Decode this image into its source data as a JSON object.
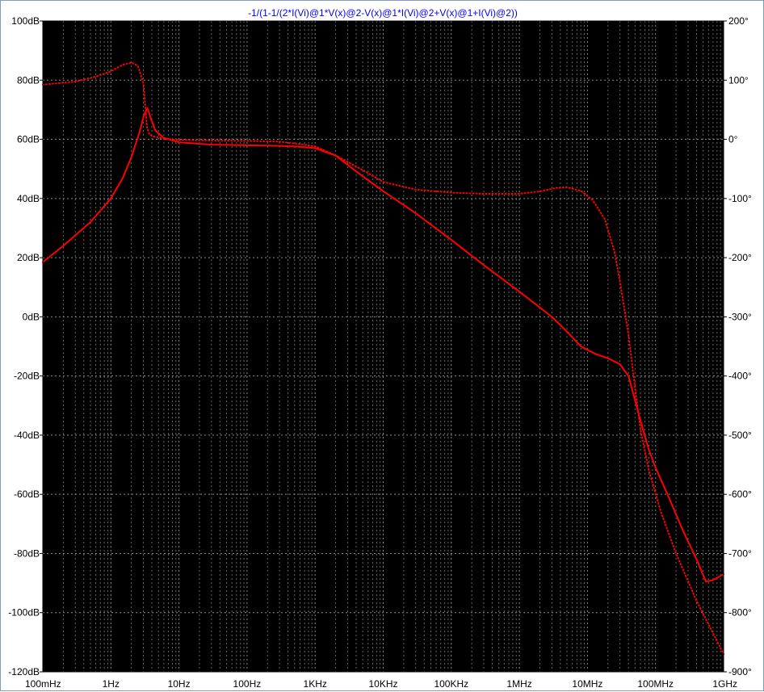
{
  "window": {
    "background": "#ffffff",
    "plot_background": "#000000",
    "grid_color": "#8a8a8a",
    "title_color": "#0000ff",
    "trace_color": "#ff0000"
  },
  "chart_data": {
    "type": "line",
    "title": "-1/(1-1/(2*I(Vi)@1*V(x)@2-V(x)@1*I(Vi)@2+V(x)@1+I(Vi)@2))",
    "x_scale": "log",
    "xlim": [
      0.1,
      1000000000
    ],
    "x_ticks": [
      {
        "value": 0.1,
        "label": "100mHz"
      },
      {
        "value": 1,
        "label": "1Hz"
      },
      {
        "value": 10,
        "label": "10Hz"
      },
      {
        "value": 100,
        "label": "100Hz"
      },
      {
        "value": 1000,
        "label": "1KHz"
      },
      {
        "value": 10000,
        "label": "10KHz"
      },
      {
        "value": 100000,
        "label": "100KHz"
      },
      {
        "value": 1000000,
        "label": "1MHz"
      },
      {
        "value": 10000000,
        "label": "10MHz"
      },
      {
        "value": 100000000,
        "label": "100MHz"
      },
      {
        "value": 1000000000,
        "label": "1GHz"
      }
    ],
    "y_left": {
      "ylim": [
        -120,
        100
      ],
      "ticks": [
        {
          "value": 100,
          "label": "100dB"
        },
        {
          "value": 80,
          "label": "80dB"
        },
        {
          "value": 60,
          "label": "60dB"
        },
        {
          "value": 40,
          "label": "40dB"
        },
        {
          "value": 20,
          "label": "20dB"
        },
        {
          "value": 0,
          "label": "0dB"
        },
        {
          "value": -20,
          "label": "-20dB"
        },
        {
          "value": -40,
          "label": "-40dB"
        },
        {
          "value": -60,
          "label": "-60dB"
        },
        {
          "value": -80,
          "label": "-80dB"
        },
        {
          "value": -100,
          "label": "-100dB"
        },
        {
          "value": -120,
          "label": "-120dB"
        }
      ]
    },
    "y_right": {
      "ylim": [
        -900,
        200
      ],
      "ticks": [
        {
          "value": 200,
          "label": "200°"
        },
        {
          "value": 100,
          "label": "100°"
        },
        {
          "value": 0,
          "label": "0°"
        },
        {
          "value": -100,
          "label": "-100°"
        },
        {
          "value": -200,
          "label": "-200°"
        },
        {
          "value": -300,
          "label": "-300°"
        },
        {
          "value": -400,
          "label": "-400°"
        },
        {
          "value": -500,
          "label": "-500°"
        },
        {
          "value": -600,
          "label": "-600°"
        },
        {
          "value": -700,
          "label": "-700°"
        },
        {
          "value": -800,
          "label": "-800°"
        },
        {
          "value": -900,
          "label": "-900°"
        }
      ]
    },
    "grid": true,
    "series": [
      {
        "axis": "left",
        "style": "solid",
        "color": "#ff0000",
        "points": [
          [
            0.1,
            18.5
          ],
          [
            0.2,
            24
          ],
          [
            0.5,
            32
          ],
          [
            1,
            40
          ],
          [
            1.5,
            47
          ],
          [
            2,
            54
          ],
          [
            2.6,
            62
          ],
          [
            3.1,
            68.5
          ],
          [
            3.45,
            70.5
          ],
          [
            3.8,
            67.5
          ],
          [
            4.5,
            63
          ],
          [
            6,
            60.5
          ],
          [
            10,
            59
          ],
          [
            30,
            58.2
          ],
          [
            100,
            58
          ],
          [
            300,
            57.8
          ],
          [
            600,
            57.5
          ],
          [
            1000,
            57
          ],
          [
            2000,
            54.5
          ],
          [
            5000,
            47.5
          ],
          [
            10000,
            42.5
          ],
          [
            30000,
            35
          ],
          [
            100000,
            26
          ],
          [
            300000,
            17.5
          ],
          [
            1000000,
            8.5
          ],
          [
            3000000,
            0
          ],
          [
            5000000,
            -5
          ],
          [
            8000000,
            -10
          ],
          [
            13000000,
            -12.5
          ],
          [
            20000000,
            -14
          ],
          [
            30000000,
            -16
          ],
          [
            40000000,
            -20
          ],
          [
            60000000,
            -35
          ],
          [
            80000000,
            -45
          ],
          [
            100000000,
            -51
          ],
          [
            150000000,
            -60
          ],
          [
            250000000,
            -72
          ],
          [
            400000000,
            -82
          ],
          [
            550000000,
            -89.5
          ],
          [
            700000000,
            -89
          ],
          [
            1000000000,
            -87
          ]
        ]
      },
      {
        "axis": "right",
        "style": "dotted",
        "color": "#ff0000",
        "points": [
          [
            0.1,
            92.5
          ],
          [
            0.3,
            97.5
          ],
          [
            0.6,
            106
          ],
          [
            1,
            115
          ],
          [
            1.5,
            126
          ],
          [
            2,
            130
          ],
          [
            2.5,
            124
          ],
          [
            3,
            95
          ],
          [
            3.4,
            20
          ],
          [
            3.7,
            8
          ],
          [
            4.2,
            5
          ],
          [
            6,
            1
          ],
          [
            10,
            -1
          ],
          [
            30,
            -2
          ],
          [
            100,
            -2.5
          ],
          [
            300,
            -4
          ],
          [
            600,
            -8
          ],
          [
            1000,
            -12
          ],
          [
            2000,
            -27
          ],
          [
            5000,
            -52
          ],
          [
            10000,
            -72
          ],
          [
            30000,
            -85
          ],
          [
            100000,
            -90
          ],
          [
            300000,
            -92
          ],
          [
            1000000,
            -92
          ],
          [
            2000000,
            -88
          ],
          [
            3500000,
            -82
          ],
          [
            5000000,
            -81
          ],
          [
            8000000,
            -87
          ],
          [
            12000000,
            -103
          ],
          [
            18000000,
            -135
          ],
          [
            25000000,
            -190
          ],
          [
            30000000,
            -240
          ],
          [
            40000000,
            -330
          ],
          [
            50000000,
            -420
          ],
          [
            60000000,
            -490
          ],
          [
            80000000,
            -560
          ],
          [
            120000000,
            -630
          ],
          [
            200000000,
            -700
          ],
          [
            400000000,
            -780
          ],
          [
            1000000000,
            -870
          ]
        ]
      }
    ]
  }
}
